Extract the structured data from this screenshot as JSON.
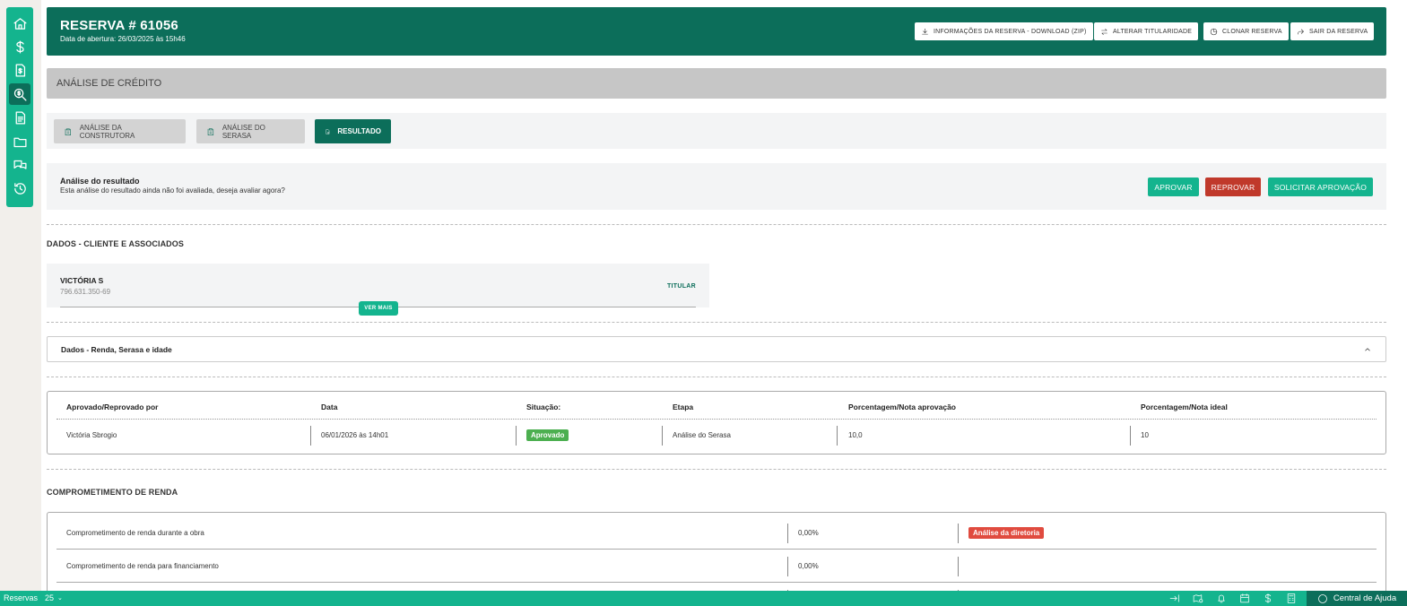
{
  "sidebar": {
    "items": [
      {
        "icon": "home-icon"
      },
      {
        "icon": "dollar-icon"
      },
      {
        "icon": "file-dollar-icon"
      },
      {
        "icon": "credit-search-icon",
        "active": true
      },
      {
        "icon": "document-icon"
      },
      {
        "icon": "folder-icon"
      },
      {
        "icon": "chat-icon"
      },
      {
        "icon": "history-icon"
      }
    ]
  },
  "header": {
    "title": "RESERVA # 61056",
    "subtitle": "Data de abertura: 26/03/2025 às 15h46",
    "buttons": {
      "download": "INFORMAÇÕES DA RESERVA - DOWNLOAD (ZIP)",
      "alterar": "ALTERAR TITULARIDADE",
      "clonar": "CLONAR RESERVA",
      "sair": "SAIR DA RESERVA"
    }
  },
  "section_band": "ANÁLISE DE CRÉDITO",
  "tabs": {
    "construtora": "ANÁLISE DA CONSTRUTORA",
    "serasa": "ANÁLISE DO SERASA",
    "resultado": "RESULTADO",
    "active": "resultado"
  },
  "result_analysis": {
    "title": "Análise do resultado",
    "subtitle": "Esta análise do resultado ainda não foi avaliada, deseja avaliar agora?",
    "approve": "APROVAR",
    "reject": "REPROVAR",
    "request": "SOLICITAR APROVAÇÃO"
  },
  "clients_section": {
    "title": "DADOS - CLIENTE E ASSOCIADOS",
    "client": {
      "name": "VICTÓRIA S",
      "doc": "796.631.350-69",
      "role": "TITULAR"
    },
    "ver_mais": "VER MAIS"
  },
  "accordion": {
    "label": "Dados - Renda, Serasa e idade"
  },
  "approval_table": {
    "headers": {
      "by": "Aprovado/Reprovado por",
      "date": "Data",
      "situation": "Situação:",
      "stage": "Etapa",
      "pct_approval": "Porcentagem/Nota aprovação",
      "pct_ideal": "Porcentagem/Nota ideal"
    },
    "row": {
      "by": "Victória Sbrogio",
      "date": "06/01/2026 às 14h01",
      "situation": "Aprovado",
      "stage": "Análise do Serasa",
      "pct_approval": "10,0",
      "pct_ideal": "10"
    }
  },
  "commitment": {
    "title": "COMPROMETIMENTO DE RENDA",
    "rows": [
      {
        "label": "Comprometimento de renda durante a obra",
        "value": "0,00%",
        "badge": "Análise da diretoria"
      },
      {
        "label": "Comprometimento de renda para financiamento",
        "value": "0,00%"
      }
    ]
  },
  "bottombar": {
    "label": "Reservas",
    "count": "25",
    "help": "Central de Ajuda"
  },
  "colors": {
    "dark_green": "#0c6e5a",
    "green": "#14b48e",
    "red": "#c0392b",
    "badge_green": "#4caf50",
    "badge_red": "#e04b3f"
  }
}
